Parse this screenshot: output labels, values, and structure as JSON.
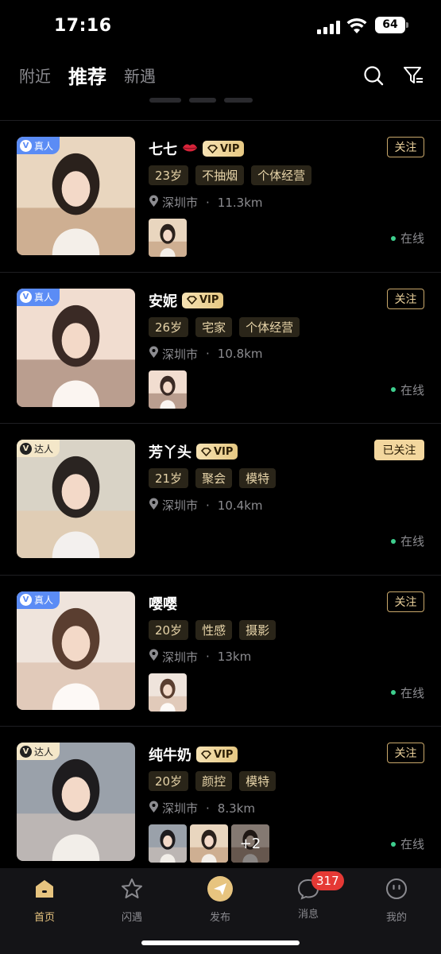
{
  "status_bar": {
    "time": "17:16",
    "battery": "64"
  },
  "top_nav": {
    "tabs": [
      "附近",
      "推荐",
      "新遇"
    ],
    "active_tab": "推荐",
    "icons": [
      "search-icon",
      "filter-icon"
    ]
  },
  "cards": [
    {
      "badge": "真人",
      "badge_type": "real",
      "name": "七七",
      "has_lips": true,
      "vip": "VIP",
      "follow": "关注",
      "followed": false,
      "tags": [
        "23岁",
        "不抽烟",
        "个体经营"
      ],
      "city": "深圳市",
      "distance": "11.3km",
      "thumb_count": 1,
      "more": "",
      "status": "在线"
    },
    {
      "badge": "真人",
      "badge_type": "real",
      "name": "安妮",
      "has_lips": false,
      "vip": "VIP",
      "follow": "关注",
      "followed": false,
      "tags": [
        "26岁",
        "宅家",
        "个体经营"
      ],
      "city": "深圳市",
      "distance": "10.8km",
      "thumb_count": 1,
      "more": "",
      "status": "在线"
    },
    {
      "badge": "达人",
      "badge_type": "star",
      "name": "芳丫头",
      "has_lips": false,
      "vip": "VIP",
      "follow": "已关注",
      "followed": true,
      "tags": [
        "21岁",
        "聚会",
        "模特"
      ],
      "city": "深圳市",
      "distance": "10.4km",
      "thumb_count": 0,
      "more": "",
      "status": "在线"
    },
    {
      "badge": "真人",
      "badge_type": "real",
      "name": "嘤嘤",
      "has_lips": false,
      "vip": "",
      "follow": "关注",
      "followed": false,
      "tags": [
        "20岁",
        "性感",
        "摄影"
      ],
      "city": "深圳市",
      "distance": "13km",
      "thumb_count": 1,
      "more": "",
      "status": "在线"
    },
    {
      "badge": "达人",
      "badge_type": "star",
      "name": "纯牛奶",
      "has_lips": false,
      "vip": "VIP",
      "follow": "关注",
      "followed": false,
      "tags": [
        "20岁",
        "颜控",
        "模特"
      ],
      "city": "深圳市",
      "distance": "8.3km",
      "thumb_count": 3,
      "more": "+2",
      "status": "在线"
    }
  ],
  "bottom_nav": {
    "items": [
      {
        "label": "首页",
        "icon": "home-icon"
      },
      {
        "label": "闪遇",
        "icon": "star-icon"
      },
      {
        "label": "发布",
        "icon": "send-icon"
      },
      {
        "label": "消息",
        "icon": "chat-icon",
        "badge": "317"
      },
      {
        "label": "我的",
        "icon": "profile-icon"
      }
    ],
    "active": "首页"
  },
  "colors": {
    "accent_gold": "#e7c47f",
    "real_badge": "#5b8cf5",
    "online_dot": "#3ecf8e",
    "unread_badge": "#e53935"
  }
}
